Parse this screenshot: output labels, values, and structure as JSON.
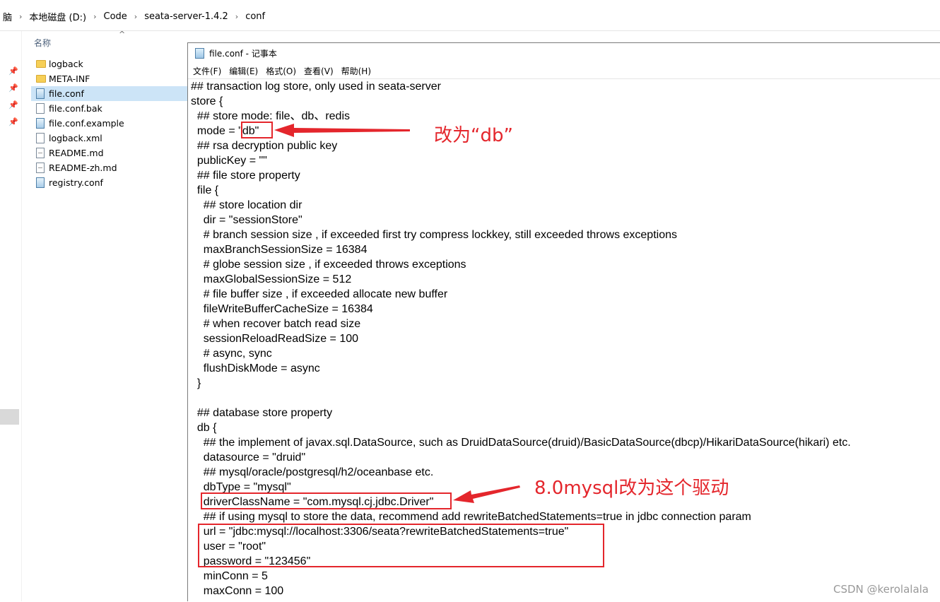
{
  "explorer": {
    "breadcrumb": [
      "脑",
      "本地磁盘 (D:)",
      "Code",
      "seata-server-1.4.2",
      "conf"
    ],
    "column_name": "名称",
    "files": [
      {
        "name": "logback",
        "icon": "folder-icon",
        "selected": false
      },
      {
        "name": "META-INF",
        "icon": "folder-icon",
        "selected": false
      },
      {
        "name": "file.conf",
        "icon": "conf-file-icon",
        "selected": true
      },
      {
        "name": "file.conf.bak",
        "icon": "file-icon",
        "selected": false
      },
      {
        "name": "file.conf.example",
        "icon": "conf-file-icon",
        "selected": false
      },
      {
        "name": "logback.xml",
        "icon": "file-icon",
        "selected": false
      },
      {
        "name": "README.md",
        "icon": "md-file-icon",
        "selected": false
      },
      {
        "name": "README-zh.md",
        "icon": "md-file-icon",
        "selected": false
      },
      {
        "name": "registry.conf",
        "icon": "conf-file-icon",
        "selected": false
      }
    ]
  },
  "notepad": {
    "title": "file.conf - 记事本",
    "menus": [
      "文件(F)",
      "编辑(E)",
      "格式(O)",
      "查看(V)",
      "帮助(H)"
    ],
    "lines": [
      "## transaction log store, only used in seata-server",
      "store {",
      "  ## store mode: file、db、redis",
      "  mode = \"db\"",
      "  ## rsa decryption public key",
      "  publicKey = \"\"",
      "  ## file store property",
      "  file {",
      "    ## store location dir",
      "    dir = \"sessionStore\"",
      "    # branch session size , if exceeded first try compress lockkey, still exceeded throws exceptions",
      "    maxBranchSessionSize = 16384",
      "    # globe session size , if exceeded throws exceptions",
      "    maxGlobalSessionSize = 512",
      "    # file buffer size , if exceeded allocate new buffer",
      "    fileWriteBufferCacheSize = 16384",
      "    # when recover batch read size",
      "    sessionReloadReadSize = 100",
      "    # async, sync",
      "    flushDiskMode = async",
      "  }",
      "",
      "  ## database store property",
      "  db {",
      "    ## the implement of javax.sql.DataSource, such as DruidDataSource(druid)/BasicDataSource(dbcp)/HikariDataSource(hikari) etc.",
      "    datasource = \"druid\"",
      "    ## mysql/oracle/postgresql/h2/oceanbase etc.",
      "    dbType = \"mysql\"",
      "    driverClassName = \"com.mysql.cj.jdbc.Driver\"",
      "    ## if using mysql to store the data, recommend add rewriteBatchedStatements=true in jdbc connection param",
      "    url = \"jdbc:mysql://localhost:3306/seata?rewriteBatchedStatements=true\"",
      "    user = \"root\"",
      "    password = \"123456\"",
      "    minConn = 5",
      "    maxConn = 100"
    ]
  },
  "annotations": {
    "mode_note": "改为“db”",
    "driver_note": "8.0mysql改为这个驱动",
    "accent_color": "#e4262c"
  },
  "watermark": "CSDN @kerolalala"
}
